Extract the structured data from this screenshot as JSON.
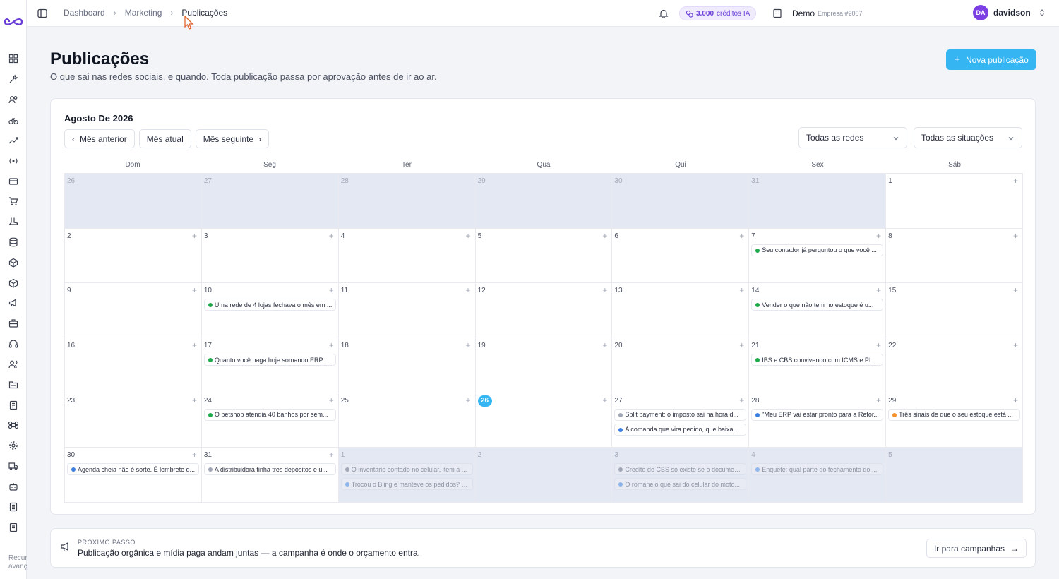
{
  "breadcrumb": [
    "Dashboard",
    "Marketing",
    "Publicações"
  ],
  "topbar": {
    "credits_value": "3.000",
    "credits_label": "créditos IA",
    "company_name": "Demo",
    "company_sub": "Empresa #2007",
    "user_initials": "DA",
    "user_name": "davidson"
  },
  "sidebar": {
    "footer_text_line1": "Recur",
    "footer_text_line2": "avanç"
  },
  "page": {
    "title": "Publicações",
    "subtitle": "O que sai nas redes sociais, e quando. Toda publicação passa por aprovação antes de ir ao ar.",
    "new_button": "Nova publicação"
  },
  "calendar": {
    "month_title": "Agosto De 2026",
    "prev_label": "Mês anterior",
    "current_label": "Mês atual",
    "next_label": "Mês seguinte",
    "filter_networks": "Todas as redes",
    "filter_status": "Todas as situações",
    "weekdays": [
      "Dom",
      "Seg",
      "Ter",
      "Qua",
      "Qui",
      "Sex",
      "Sáb"
    ],
    "status_colors": {
      "green": "#1faa4b",
      "blue": "#3b7fe0",
      "gray": "#a0a6b5",
      "orange": "#f0922e",
      "lightblue": "#8db5ec"
    },
    "weeks": [
      [
        {
          "day": "26",
          "out": true,
          "events": []
        },
        {
          "day": "27",
          "out": true,
          "events": []
        },
        {
          "day": "28",
          "out": true,
          "events": []
        },
        {
          "day": "29",
          "out": true,
          "events": []
        },
        {
          "day": "30",
          "out": true,
          "events": []
        },
        {
          "day": "31",
          "out": true,
          "events": []
        },
        {
          "day": "1",
          "out": false,
          "events": []
        }
      ],
      [
        {
          "day": "2",
          "events": []
        },
        {
          "day": "3",
          "events": []
        },
        {
          "day": "4",
          "events": []
        },
        {
          "day": "5",
          "events": []
        },
        {
          "day": "6",
          "events": []
        },
        {
          "day": "7",
          "events": [
            {
              "text": "Seu contador já perguntou o que você ...",
              "color": "green"
            }
          ]
        },
        {
          "day": "8",
          "events": []
        }
      ],
      [
        {
          "day": "9",
          "events": []
        },
        {
          "day": "10",
          "events": [
            {
              "text": "Uma rede de 4 lojas fechava o mês em ...",
              "color": "green"
            }
          ]
        },
        {
          "day": "11",
          "events": []
        },
        {
          "day": "12",
          "events": []
        },
        {
          "day": "13",
          "events": []
        },
        {
          "day": "14",
          "events": [
            {
              "text": "Vender o que não tem no estoque é u...",
              "color": "green"
            }
          ]
        },
        {
          "day": "15",
          "events": []
        }
      ],
      [
        {
          "day": "16",
          "events": []
        },
        {
          "day": "17",
          "events": [
            {
              "text": "Quanto você paga hoje somando ERP, ...",
              "color": "green"
            }
          ]
        },
        {
          "day": "18",
          "events": []
        },
        {
          "day": "19",
          "events": []
        },
        {
          "day": "20",
          "events": []
        },
        {
          "day": "21",
          "events": [
            {
              "text": "IBS e CBS convivendo com ICMS e PIS/...",
              "color": "green"
            }
          ]
        },
        {
          "day": "22",
          "events": []
        }
      ],
      [
        {
          "day": "23",
          "events": []
        },
        {
          "day": "24",
          "events": [
            {
              "text": "O petshop atendia 40 banhos por sem...",
              "color": "green"
            }
          ]
        },
        {
          "day": "25",
          "events": []
        },
        {
          "day": "26",
          "today": true,
          "events": []
        },
        {
          "day": "27",
          "events": [
            {
              "text": "Split payment: o imposto sai na hora d...",
              "color": "gray"
            },
            {
              "text": "A comanda que vira pedido, que baixa ...",
              "color": "blue"
            }
          ]
        },
        {
          "day": "28",
          "events": [
            {
              "text": "\"Meu ERP vai estar pronto para a Refor...",
              "color": "blue"
            }
          ]
        },
        {
          "day": "29",
          "events": [
            {
              "text": "Três sinais de que o seu estoque está ...",
              "color": "orange"
            }
          ]
        }
      ],
      [
        {
          "day": "30",
          "events": [
            {
              "text": "Agenda cheia não é sorte. É lembrete q...",
              "color": "blue"
            }
          ]
        },
        {
          "day": "31",
          "events": [
            {
              "text": "A distribuidora tinha tres depositos e u...",
              "color": "gray"
            }
          ]
        },
        {
          "day": "1",
          "out": true,
          "events": [
            {
              "text": "O inventario contado no celular, item a ...",
              "color": "gray"
            },
            {
              "text": "Trocou o Bling e manteve os pedidos? F...",
              "color": "lightblue"
            }
          ]
        },
        {
          "day": "2",
          "out": true,
          "events": []
        },
        {
          "day": "3",
          "out": true,
          "events": [
            {
              "text": "Credito de CBS so existe se o documen...",
              "color": "gray"
            },
            {
              "text": "O romaneio que sai do celular do moto...",
              "color": "lightblue"
            }
          ]
        },
        {
          "day": "4",
          "out": true,
          "events": [
            {
              "text": "Enquete: qual parte do fechamento do ...",
              "color": "lightblue"
            }
          ]
        },
        {
          "day": "5",
          "out": true,
          "events": []
        }
      ]
    ]
  },
  "next_step": {
    "label": "PRÓXIMO PASSO",
    "text": "Publicação orgânica e mídia paga andam juntas — a campanha é onde o orçamento entra.",
    "button": "Ir para campanhas"
  }
}
